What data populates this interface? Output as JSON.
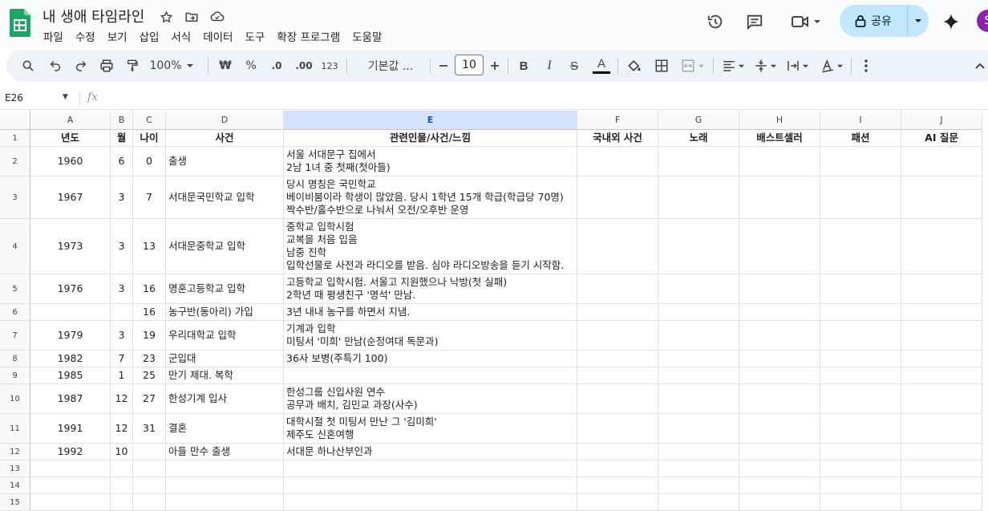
{
  "header": {
    "title": "내 생애 타임라인",
    "share_label": "공유",
    "avatar_initial": "S"
  },
  "menu": [
    "파일",
    "수정",
    "보기",
    "삽입",
    "서식",
    "데이터",
    "도구",
    "확장 프로그램",
    "도움말"
  ],
  "toolbar": {
    "zoom": "100%",
    "currency": "₩",
    "percent": "%",
    "dec_decrease": ".0",
    "dec_increase": ".00",
    "number_format": "123",
    "font_name": "기본값 ...",
    "font_size": "10",
    "bold": "B",
    "italic": "I",
    "strike": "S",
    "text_color_letter": "A"
  },
  "formula_bar": {
    "name_box": "E26",
    "fx": "fx",
    "content": ""
  },
  "sheet": {
    "columns": [
      "A",
      "B",
      "C",
      "D",
      "E",
      "F",
      "G",
      "H",
      "I",
      "J"
    ],
    "selected_column": "E",
    "row_numbers": [
      "1",
      "2",
      "3",
      "4",
      "5",
      "6",
      "7",
      "8",
      "9",
      "10",
      "11",
      "12",
      "13",
      "14",
      "15"
    ],
    "header_row": [
      "년도",
      "월",
      "나이",
      "사건",
      "관련인물/사건/느낌",
      "국내외 사건",
      "노래",
      "배스트셀러",
      "패션",
      "AI 질문"
    ],
    "rows": [
      [
        "1960",
        "6",
        "0",
        "출생",
        "서울 서대문구 집에서\n2남 1녀 중 첫째(첫아들)"
      ],
      [
        "1967",
        "3",
        "7",
        "서대문국민학교 입학",
        "당시 명칭은 국민학교\n베이비붐이라 학생이 많았음. 당시 1학년 15개 학급(학급당 70명)\n짝수반/홀수반으로 나눠서 오전/오후반 운영"
      ],
      [
        "1973",
        "3",
        "13",
        "서대문중학교 입학",
        "중학교 입학시험\n교복을 처음 입음\n남중 진학\n입학선물로 사전과 라디오를 받음. 심야 라디오방송을 듣기 시작함."
      ],
      [
        "1976",
        "3",
        "16",
        "명훈고등학교 입학",
        "고등학교 입학시험. 서울고 지원했으나 낙방(첫 실패)\n2학년 때 평생친구 '명석' 만남."
      ],
      [
        "",
        "",
        "16",
        "농구반(동아리) 가입",
        "3년 내내 농구를 하면서 지냄."
      ],
      [
        "1979",
        "3",
        "19",
        "우리대학교 입학",
        "기계과 입학\n미팅서 '미희' 만남(순정여대 독문과)"
      ],
      [
        "1982",
        "7",
        "23",
        "군입대",
        "36사 보병(주특기 100)"
      ],
      [
        "1985",
        "1",
        "25",
        "만기 제대. 복학",
        ""
      ],
      [
        "1987",
        "12",
        "27",
        "한성기계 입사",
        "한성그룹 신입사원 연수\n공무과 배치, 김민교 과장(사수)"
      ],
      [
        "1991",
        "12",
        "31",
        "결혼",
        "대학시절 첫 미팅서 만난 그 '김미희'\n제주도 신혼여행"
      ],
      [
        "1992",
        "10",
        "",
        "아들 만수 출생",
        "서대문 하나산부인과"
      ],
      [
        "",
        "",
        "",
        "",
        ""
      ],
      [
        "",
        "",
        "",
        "",
        ""
      ],
      [
        "",
        "",
        "",
        "",
        ""
      ]
    ]
  }
}
